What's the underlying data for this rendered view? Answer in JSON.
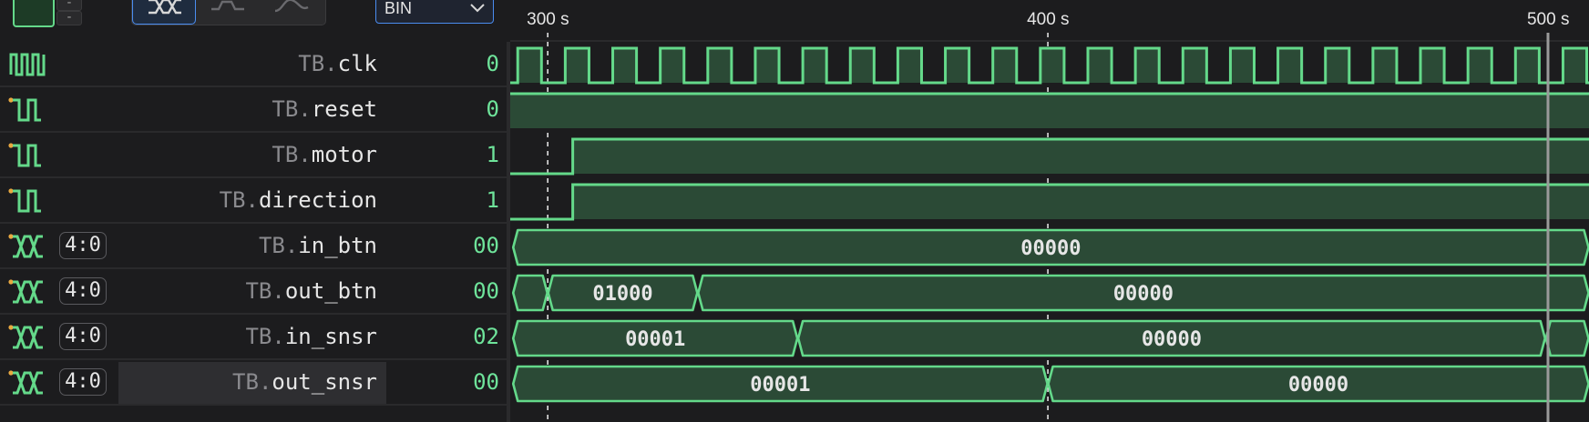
{
  "toolbar": {
    "color_swatch": "#1d3b26",
    "mini_buttons": [
      "-",
      "-"
    ],
    "modes": [
      {
        "icon": "bus-waveform-icon",
        "active": true
      },
      {
        "icon": "step-waveform-icon",
        "active": false
      },
      {
        "icon": "analog-waveform-icon",
        "active": false
      }
    ],
    "radix": {
      "value": "BIN",
      "icon": "chevron-down-icon"
    }
  },
  "timeline": {
    "ticks": [
      {
        "label": "300 s",
        "time": 300
      },
      {
        "label": "400 s",
        "time": 400
      },
      {
        "label": "500 s",
        "time": 500
      }
    ],
    "view_start": 292.5,
    "view_end": 508.2,
    "cursor_time": 500
  },
  "signals": [
    {
      "scope": "TB.",
      "name": "clk",
      "icon": "clock-signal-icon",
      "range": "",
      "value": "0",
      "wave": {
        "kind": "clock",
        "start": 292.5,
        "period": 9.5,
        "first_high": 294
      }
    },
    {
      "scope": "TB.",
      "name": "reset",
      "icon": "bit-signal-icon",
      "range": "",
      "value": "0",
      "wave": {
        "kind": "bit",
        "start_level": 1,
        "edges": []
      }
    },
    {
      "scope": "TB.",
      "name": "motor",
      "icon": "bit-signal-icon",
      "range": "",
      "value": "1",
      "wave": {
        "kind": "bit",
        "start_level": 0,
        "edges": [
          305
        ]
      }
    },
    {
      "scope": "TB.",
      "name": "direction",
      "icon": "bit-signal-icon",
      "range": "",
      "value": "1",
      "wave": {
        "kind": "bit",
        "start_level": 0,
        "edges": [
          305
        ]
      }
    },
    {
      "scope": "TB.",
      "name": "in_btn",
      "icon": "bus-signal-icon",
      "range": "4:0",
      "value": "00",
      "wave": {
        "kind": "bus",
        "segments": [
          {
            "start": 293,
            "end": 508.2,
            "label": "00000"
          }
        ]
      }
    },
    {
      "scope": "TB.",
      "name": "out_btn",
      "icon": "bus-signal-icon",
      "range": "4:0",
      "value": "00",
      "wave": {
        "kind": "bus",
        "segments": [
          {
            "start": 293,
            "end": 300,
            "label": ""
          },
          {
            "start": 300,
            "end": 330,
            "label": "01000"
          },
          {
            "start": 330,
            "end": 508.2,
            "label": "00000"
          }
        ]
      }
    },
    {
      "scope": "TB.",
      "name": "in_snsr",
      "icon": "bus-signal-icon",
      "range": "4:0",
      "value": "02",
      "wave": {
        "kind": "bus",
        "segments": [
          {
            "start": 293,
            "end": 350,
            "label": "00001"
          },
          {
            "start": 350,
            "end": 499.5,
            "label": "00000"
          },
          {
            "start": 499.5,
            "end": 508.2,
            "label": ""
          }
        ]
      }
    },
    {
      "scope": "TB.",
      "name": "out_snsr",
      "icon": "bus-signal-icon",
      "range": "4:0",
      "value": "00",
      "selected": true,
      "wave": {
        "kind": "bus",
        "segments": [
          {
            "start": 293,
            "end": 400,
            "label": "00001"
          },
          {
            "start": 400,
            "end": 508.2,
            "label": "00000"
          }
        ]
      }
    }
  ],
  "colors": {
    "wave": "#64d98a",
    "wave_fill": "#2b4a36",
    "value": "#6ee39a",
    "tick_line": "#e0e0e0",
    "cursor": "#9a9a9a",
    "icon_dot": "#e8a840"
  }
}
